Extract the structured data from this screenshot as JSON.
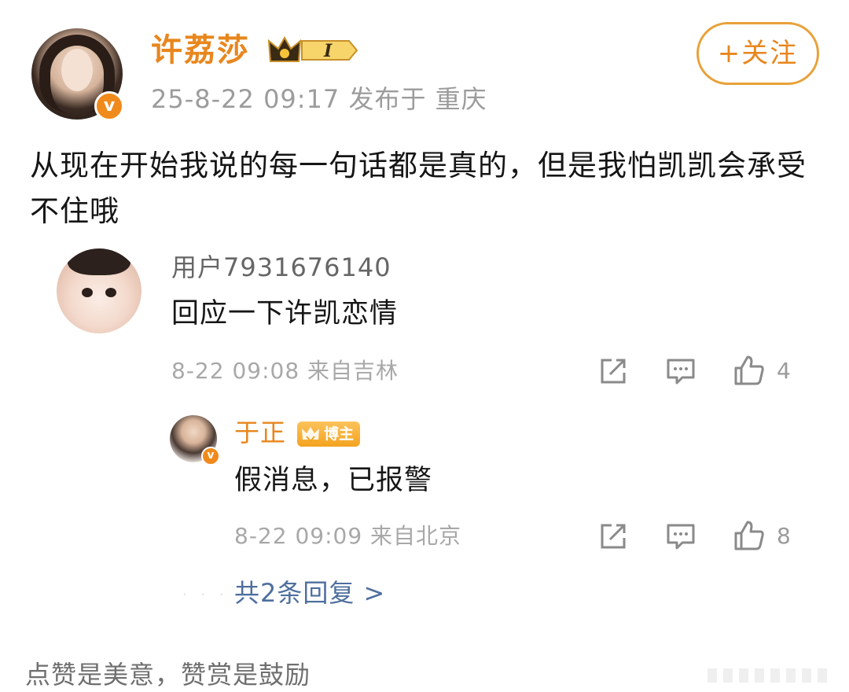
{
  "post": {
    "author": "许荔莎",
    "level": "I",
    "meta": "25-8-22 09:17  发布于 重庆",
    "follow_label": "+关注",
    "text": "从现在开始我说的每一句话都是真的，但是我怕凯凯会承受不住哦"
  },
  "comment": {
    "user": "用户7931676140",
    "text": "回应一下许凯恋情",
    "meta": "8-22 09:08 来自吉林",
    "like_count": "4"
  },
  "reply": {
    "user": "于正",
    "badge": "博主",
    "text": "假消息，已报警",
    "meta": "8-22 09:09 来自北京",
    "like_count": "8"
  },
  "more_replies": "共2条回复 >",
  "footer": "点赞是美意，赞赏是鼓励",
  "colors": {
    "accent_orange": "#e8861d",
    "link_blue": "#4f6f9e",
    "meta_gray": "#a8a8a8"
  },
  "icons": [
    "verified-v-icon",
    "crown-level-icon",
    "share-icon",
    "comment-icon",
    "like-thumb-icon"
  ]
}
